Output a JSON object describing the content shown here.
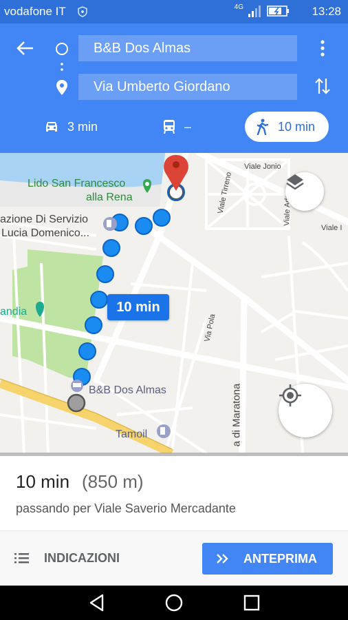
{
  "status_bar": {
    "carrier": "vodafone IT",
    "network": "4G",
    "time": "13:28"
  },
  "directions": {
    "origin": "B&B Dos Almas",
    "destination": "Via Umberto Giordano",
    "modes": [
      {
        "name": "car",
        "label": "3 min"
      },
      {
        "name": "transit",
        "label": "–"
      },
      {
        "name": "walk",
        "label": "10 min",
        "selected": true
      }
    ]
  },
  "map": {
    "labels": {
      "lido": "Lido San Francesco",
      "lido2": "alla Rena",
      "stazione": "azione Di Servizio",
      "stazione2": "Lucia Domenico...",
      "andia": "andia",
      "viale_jonio": "Viale Jonio",
      "viale_tirreno": "Viale Tirreno",
      "viale_adr": "Viale Adr",
      "viale_i": "Viale I",
      "via_pola": "Via Pola",
      "maratona": "a di Maratona",
      "bb": "B&B Dos Almas",
      "tamoil": "Tamoil"
    },
    "route_duration": "10 min",
    "colors": {
      "route": "#1a8bf0",
      "park": "#bfe3a3",
      "water": "#a9d3f5",
      "pin": "#db4437"
    }
  },
  "summary": {
    "duration": "10 min",
    "distance": "(850 m)",
    "via": "passando per Viale Saverio Mercadante"
  },
  "actions": {
    "directions_label": "INDICAZIONI",
    "preview_label": "ANTEPRIMA"
  }
}
